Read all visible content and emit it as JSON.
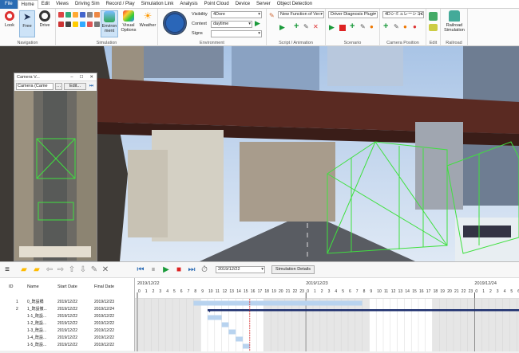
{
  "menu": {
    "file": "File",
    "items": [
      "Home",
      "Edit",
      "Views",
      "Driving Sim",
      "Record / Play",
      "Simulation Link",
      "Analysis",
      "Point Cloud",
      "Device",
      "Server",
      "Object Detection"
    ]
  },
  "ribbon": {
    "look": "Look",
    "free": "Free",
    "drive": "Drive",
    "navigation_label": "Navigation",
    "environment_btn": "Environ\nment",
    "visual_options": "Visual\nOptions",
    "simulation_label": "Simulation",
    "weather": "Weather",
    "environment_label": "Environment",
    "visibility_label": "Visibility",
    "visibility_value": "4Dore",
    "context_label": "Context",
    "context_value": "daytime",
    "signs_label": "Signs",
    "signs_value": "",
    "script_value": "New Function of Ver.",
    "script_label": "Script / Animation",
    "scenario_value": "Driver Diagnosis Plugi",
    "scenario_label": "Scenario",
    "camera_value": "4Dシミュレーション",
    "camera_label": "Camera Position",
    "edit_label": "Edit",
    "railroad_btn": "Railroad\nSimulation",
    "railroad_label": "Railroad"
  },
  "camera_window": {
    "title": "Camera V...",
    "combo_value": "Camera (Came",
    "edit_btn": "Edit..."
  },
  "timeline": {
    "date_value": "2019/12/22",
    "details_btn": "Simulation Details",
    "columns": [
      "ID",
      "Name",
      "Start Date",
      "Final Date"
    ],
    "day_labels": [
      "2019/12/22",
      "2019/12/23",
      "2019/12/24"
    ],
    "hours": [
      "0",
      "1",
      "2",
      "3",
      "4",
      "5",
      "6",
      "7",
      "8",
      "9",
      "10",
      "11",
      "12",
      "13",
      "14",
      "15",
      "16",
      "17",
      "18",
      "19",
      "20",
      "21",
      "22",
      "23"
    ],
    "rows": [
      {
        "id": "1",
        "name": "0_既設橋",
        "start": "2019/12/22",
        "final": "2019/12/23"
      },
      {
        "id": "2",
        "name": "1_既設撤...",
        "start": "2019/12/22",
        "final": "2019/12/24"
      },
      {
        "id": "",
        "name": "1-1_既設...",
        "start": "2019/12/22",
        "final": "2019/12/22"
      },
      {
        "id": "",
        "name": "1-2_既設...",
        "start": "2019/12/22",
        "final": "2019/12/22"
      },
      {
        "id": "",
        "name": "1-3_既設...",
        "start": "2019/12/22",
        "final": "2019/12/22"
      },
      {
        "id": "",
        "name": "1-4_既設...",
        "start": "2019/12/22",
        "final": "2019/12/22"
      },
      {
        "id": "",
        "name": "1-5_既設...",
        "start": "2019/12/22",
        "final": "2019/12/22"
      }
    ]
  },
  "colors": {
    "file_blue": "#2b6cb3",
    "bar_blue": "#b8d3ef",
    "summary": "#1d2f6e",
    "wireframe": "#3fe03f"
  }
}
